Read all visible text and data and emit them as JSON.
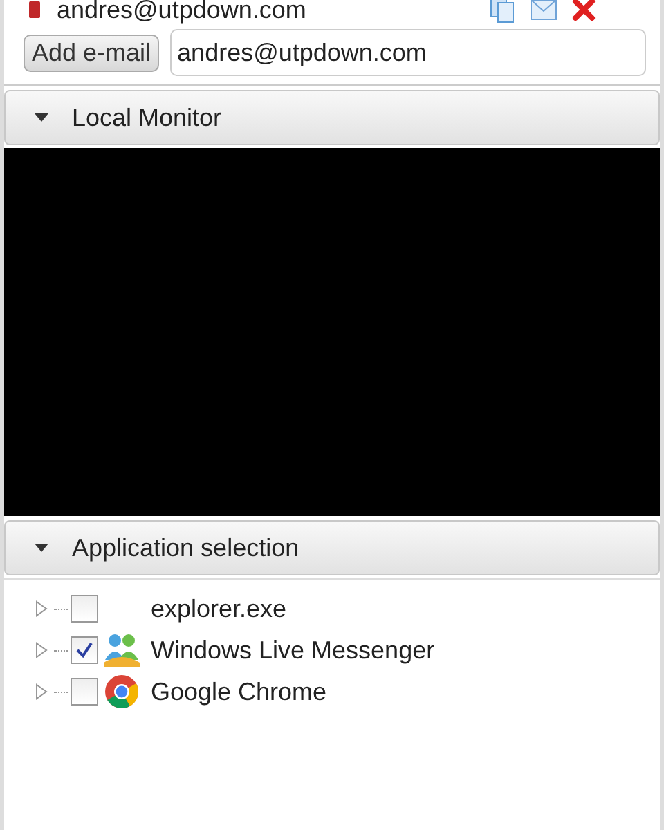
{
  "email_entry": {
    "address": "andres@utpdown.com"
  },
  "add_email": {
    "button": "Add e-mail",
    "value": "andres@utpdown.com"
  },
  "sections": [
    {
      "title": "Local Monitor",
      "expanded": true
    },
    {
      "title": "Application selection",
      "expanded": true
    }
  ],
  "applications": [
    {
      "name": "explorer.exe",
      "kind": "plain",
      "checked": false,
      "expanded": false
    },
    {
      "name": "Windows Live Messenger",
      "kind": "messenger",
      "checked": true,
      "expanded": false
    },
    {
      "name": "Google Chrome",
      "kind": "chrome",
      "checked": false,
      "expanded": false
    }
  ]
}
